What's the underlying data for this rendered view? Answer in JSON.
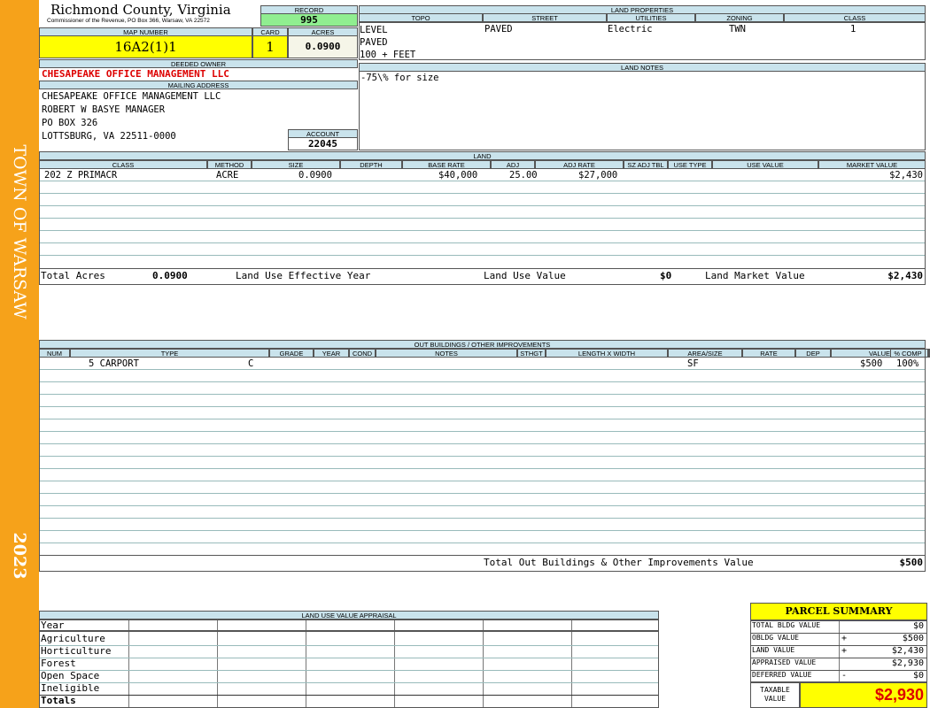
{
  "sidebar": {
    "town": "TOWN OF WARSAW",
    "year": "2023"
  },
  "header": {
    "county": "Richmond County, Virginia",
    "subtitle": "Commissioner of the Revenue, PO Box 366, Warsaw, VA 22572"
  },
  "record": {
    "label": "RECORD",
    "value": "995"
  },
  "map_number": {
    "label": "MAP NUMBER",
    "value": "16A2(1)1"
  },
  "card": {
    "label": "CARD",
    "value": "1"
  },
  "acres": {
    "label": "ACRES",
    "value": "0.0900"
  },
  "deeded_owner": {
    "label": "DEEDED OWNER",
    "value": "CHESAPEAKE OFFICE MANAGEMENT LLC"
  },
  "mailing": {
    "label": "MAILING ADDRESS",
    "lines": [
      "CHESAPEAKE OFFICE MANAGEMENT LLC",
      "ROBERT W BASYE MANAGER",
      "PO BOX 326",
      "LOTTSBURG, VA 22511-0000"
    ]
  },
  "account": {
    "label": "ACCOUNT",
    "value": "22045"
  },
  "land_properties": {
    "label": "LAND PROPERTIES",
    "headers": [
      "TOPO",
      "STREET",
      "UTILITIES",
      "ZONING",
      "CLASS"
    ],
    "topo": [
      "LEVEL",
      "PAVED",
      "100 + FEET"
    ],
    "street": "PAVED",
    "utilities": "Electric",
    "zoning": "TWN",
    "class": "1"
  },
  "land_notes": {
    "label": "LAND NOTES",
    "text": "-75\\% for size"
  },
  "land": {
    "label": "LAND",
    "headers": [
      "CLASS",
      "METHOD",
      "SIZE",
      "DEPTH",
      "BASE RATE",
      "ADJ",
      "ADJ RATE",
      "SZ ADJ TBL",
      "USE TYPE",
      "USE VALUE",
      "MARKET VALUE"
    ],
    "row": {
      "class": "202 Z PRIMACR",
      "method": "ACRE",
      "size": "0.0900",
      "base_rate": "$40,000",
      "adj": "25.00",
      "adj_rate": "$27,000",
      "market_value": "$2,430"
    },
    "totals": {
      "total_acres_label": "Total Acres",
      "total_acres": "0.0900",
      "use_year_label": "Land Use Effective Year",
      "use_value_label": "Land Use Value",
      "use_value": "$0",
      "market_label": "Land Market Value",
      "market_value": "$2,430"
    }
  },
  "outbuildings": {
    "label": "OUT BUILDINGS / OTHER IMPROVEMENTS",
    "headers": [
      "NUM",
      "TYPE",
      "GRADE",
      "YEAR",
      "COND",
      "NOTES",
      "STHGT",
      "LENGTH X WIDTH",
      "AREA/SIZE",
      "RATE",
      "DEP",
      "VALUE",
      "% COMP"
    ],
    "row": {
      "type": "5 CARPORT",
      "grade": "C",
      "area": "SF",
      "value": "$500",
      "comp": "100%"
    },
    "total_label": "Total Out Buildings & Other Improvements Value",
    "total_value": "$500"
  },
  "land_use": {
    "label": "LAND USE VALUE APPRAISAL",
    "rows": [
      "Year",
      "Agriculture",
      "Horticulture",
      "Forest",
      "Open Space",
      "Ineligible",
      "Totals"
    ]
  },
  "summary": {
    "title": "PARCEL SUMMARY",
    "rows": [
      {
        "label": "TOTAL BLDG VALUE",
        "sign": "",
        "value": "$0"
      },
      {
        "label": "OBLDG VALUE",
        "sign": "+",
        "value": "$500"
      },
      {
        "label": "LAND VALUE",
        "sign": "+",
        "value": "$2,430"
      },
      {
        "label": "APPRAISED VALUE",
        "sign": "",
        "value": "$2,930"
      },
      {
        "label": "DEFERRED VALUE",
        "sign": "-",
        "value": "$0"
      }
    ],
    "taxable_label": "TAXABLE VALUE",
    "taxable_value": "$2,930"
  }
}
